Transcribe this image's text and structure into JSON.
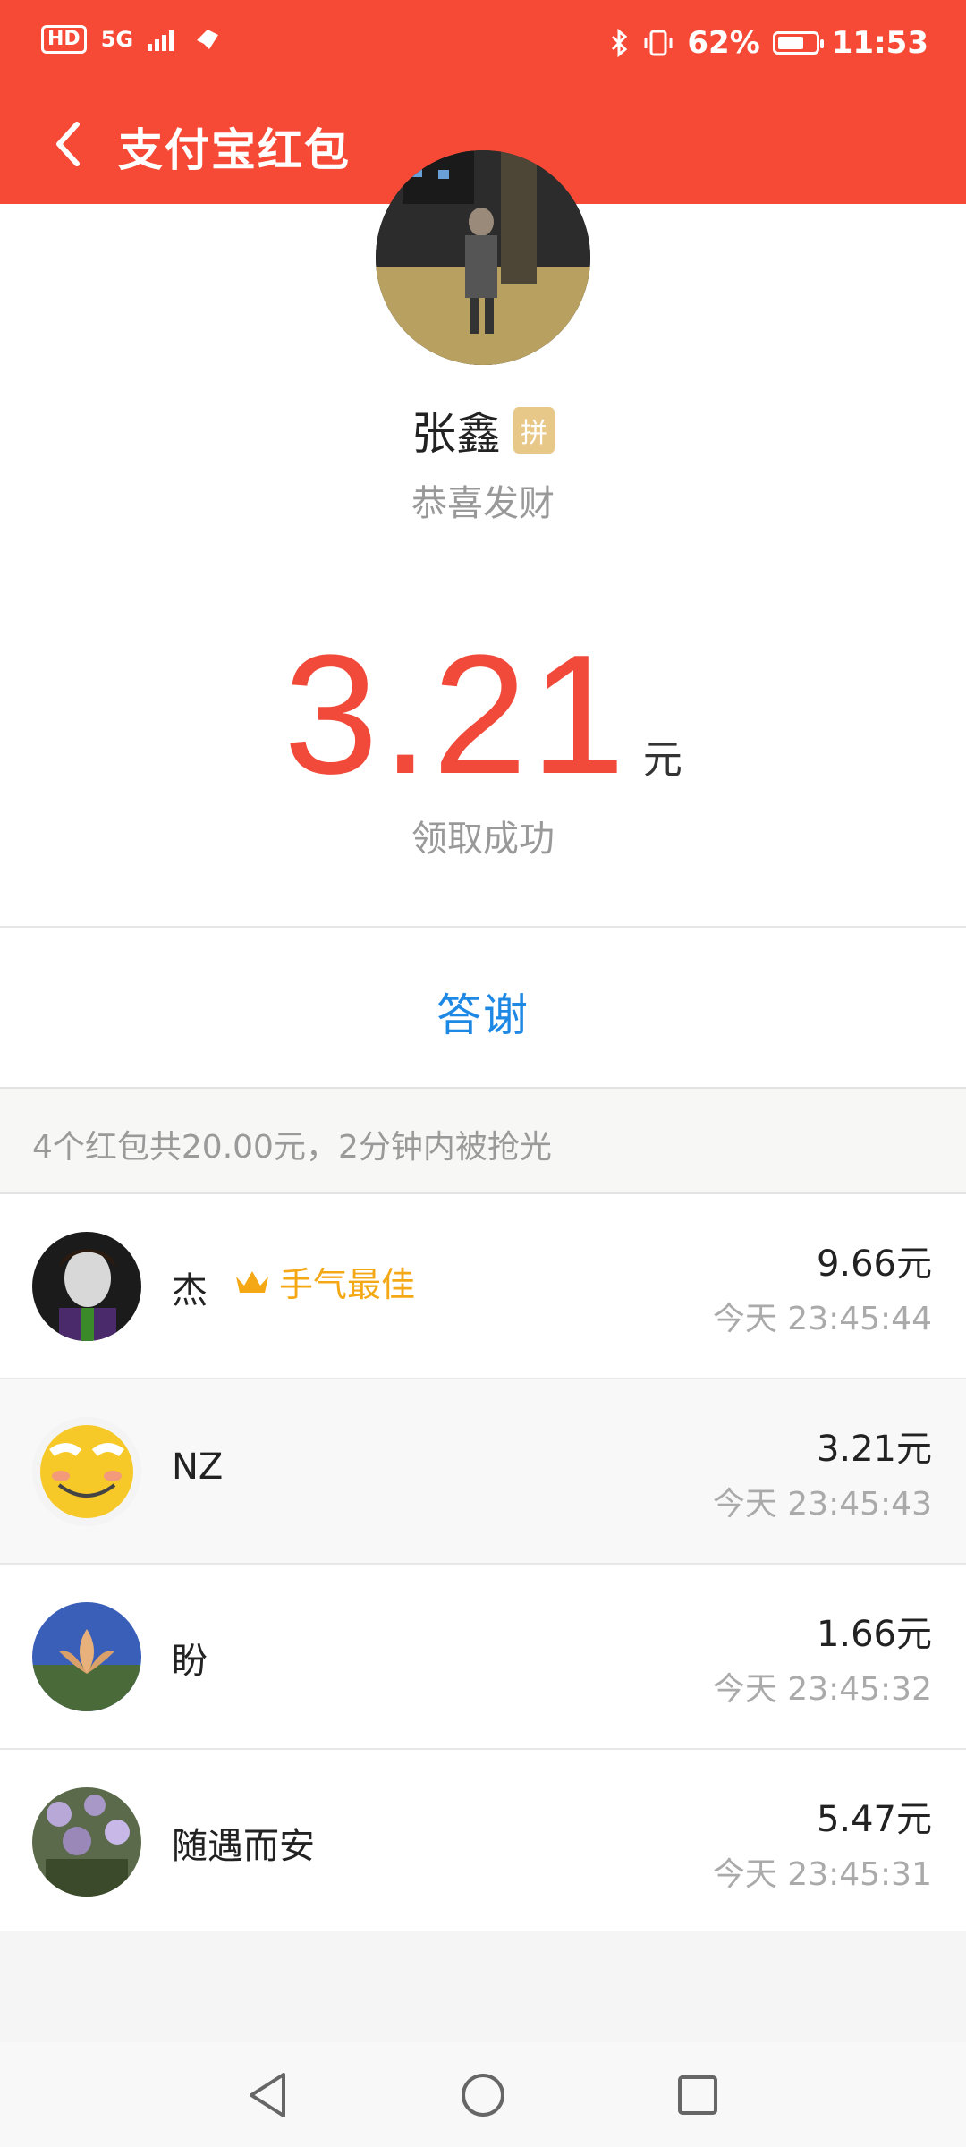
{
  "status_bar": {
    "left_badges": [
      "HD",
      "5G"
    ],
    "battery_percent": "62%",
    "time": "11:53"
  },
  "header": {
    "title": "支付宝红包",
    "back_icon": "chevron-left-icon",
    "bg": "#f74a36"
  },
  "sender": {
    "name": "张鑫",
    "badge": "拼",
    "wish": "恭喜发财"
  },
  "amount": {
    "value": "3.21",
    "unit": "元",
    "status": "领取成功",
    "color": "#f24a3a"
  },
  "thanks": {
    "label": "答谢",
    "color": "#1e88e5"
  },
  "summary": "4个红包共20.00元，2分钟内被抢光",
  "receivers": [
    {
      "name": "杰",
      "best_label": "手气最佳",
      "amount": "9.66元",
      "time": "今天 23:45:44"
    },
    {
      "name": "NZ",
      "amount": "3.21元",
      "time": "今天 23:45:43"
    },
    {
      "name": "盼",
      "amount": "1.66元",
      "time": "今天 23:45:32"
    },
    {
      "name": "随遇而安",
      "amount": "5.47元",
      "time": "今天 23:45:31"
    }
  ],
  "nav_icons": [
    "back-triangle-icon",
    "home-circle-icon",
    "recents-square-icon"
  ]
}
